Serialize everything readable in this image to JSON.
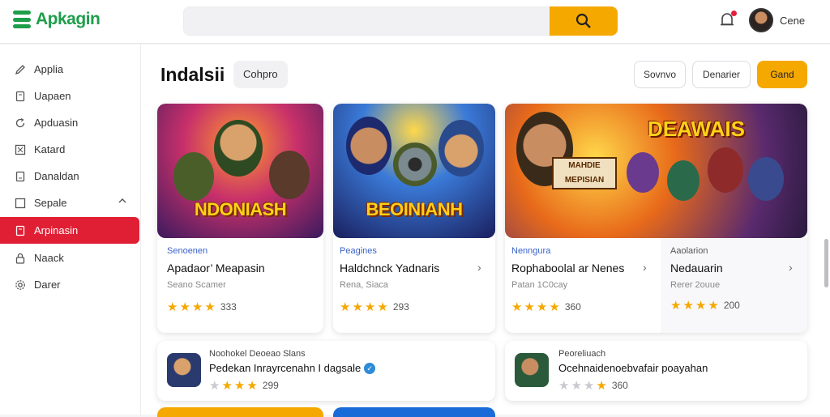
{
  "app": {
    "name": "Apkagin"
  },
  "search": {
    "placeholder": ""
  },
  "user": {
    "name": "Cene"
  },
  "sidebar": {
    "items": [
      {
        "label": "Applia",
        "icon": "pen-icon"
      },
      {
        "label": "Uapaen",
        "icon": "doc-icon"
      },
      {
        "label": "Apduasin",
        "icon": "refresh-icon"
      },
      {
        "label": "Katard",
        "icon": "box-icon"
      },
      {
        "label": "Danaldan",
        "icon": "doc-icon"
      },
      {
        "label": "Sepale",
        "icon": "square-icon"
      },
      {
        "label": "Arpinasin",
        "icon": "doc-icon"
      },
      {
        "label": "Naack",
        "icon": "lock-icon"
      },
      {
        "label": "Darer",
        "icon": "gear-icon"
      }
    ]
  },
  "main": {
    "title": "Indalsii",
    "filter_pill": "Cohpro",
    "buttons": {
      "secondary1": "Sovnvo",
      "secondary2": "Denarier",
      "primary": "Gand"
    },
    "featured": [
      {
        "thumb_title": "NDONIASH",
        "category": "Senoenen",
        "title": "Apadaor’ Meapasin",
        "subtitle": "Seano Scamer",
        "rating": "333",
        "stars": 4
      },
      {
        "thumb_title": "BEOINIANH",
        "category": "Peagines",
        "title": "Haldchnck Yadnaris",
        "subtitle": "Rena, Siaca",
        "rating": "293",
        "stars": 4
      },
      {
        "thumb_title": "DEAWAIS",
        "category": "Nenngura",
        "title": "Rophaboolal ar Nenes",
        "subtitle": "Patan 1C0cay",
        "rating": "360",
        "stars": 4
      },
      {
        "category": "Aaolarion",
        "title": "Nedauarin",
        "subtitle": "Rerer 2ouue",
        "rating": "200",
        "stars": 4
      }
    ],
    "list": [
      {
        "title": "Noohokel Deoeao Slans",
        "subtitle": "Pedekan Inrayrcenahn I dagsale",
        "rating": "299",
        "stars": 3
      },
      {
        "title": "Peoreliuach",
        "subtitle": "Ocehnaidenoebvafair poayahan",
        "rating": "360",
        "stars": 1
      }
    ]
  },
  "colors": {
    "accent": "#f5a800",
    "active": "#e01f34",
    "brand": "#1e9e4a",
    "link": "#3a62c9"
  }
}
